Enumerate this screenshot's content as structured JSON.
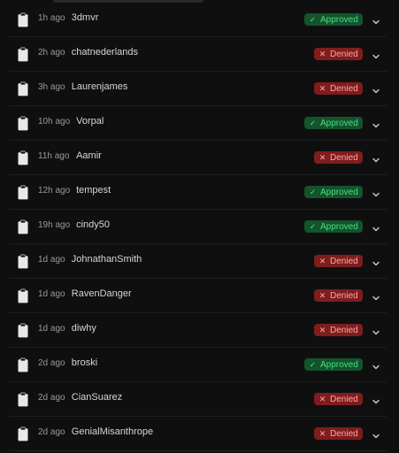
{
  "colors": {
    "approved_bg": "#14532d",
    "approved_fg": "#4ade80",
    "denied_bg": "#7f1d1d",
    "denied_fg": "#fca5a5"
  },
  "icons": {
    "row_icon": "clipboard-icon",
    "approved_icon": "check-icon",
    "denied_icon": "x-icon",
    "expand_icon": "chevron-down-icon"
  },
  "rows": [
    {
      "time": "1h ago",
      "name": "3dmvr",
      "status": "Approved"
    },
    {
      "time": "2h ago",
      "name": "chatnederlands",
      "status": "Denied"
    },
    {
      "time": "3h ago",
      "name": "Laurenjames",
      "status": "Denied"
    },
    {
      "time": "10h ago",
      "name": "Vorpal",
      "status": "Approved"
    },
    {
      "time": "11h ago",
      "name": "Aamir",
      "status": "Denied"
    },
    {
      "time": "12h ago",
      "name": "tempest",
      "status": "Approved"
    },
    {
      "time": "19h ago",
      "name": "cindy50",
      "status": "Approved"
    },
    {
      "time": "1d ago",
      "name": "JohnathanSmith",
      "status": "Denied"
    },
    {
      "time": "1d ago",
      "name": "RavenDanger",
      "status": "Denied"
    },
    {
      "time": "1d ago",
      "name": "diwhy",
      "status": "Denied"
    },
    {
      "time": "2d ago",
      "name": "broski",
      "status": "Approved"
    },
    {
      "time": "2d ago",
      "name": "CianSuarez",
      "status": "Denied"
    },
    {
      "time": "2d ago",
      "name": "GenialMisanthrope",
      "status": "Denied"
    }
  ]
}
